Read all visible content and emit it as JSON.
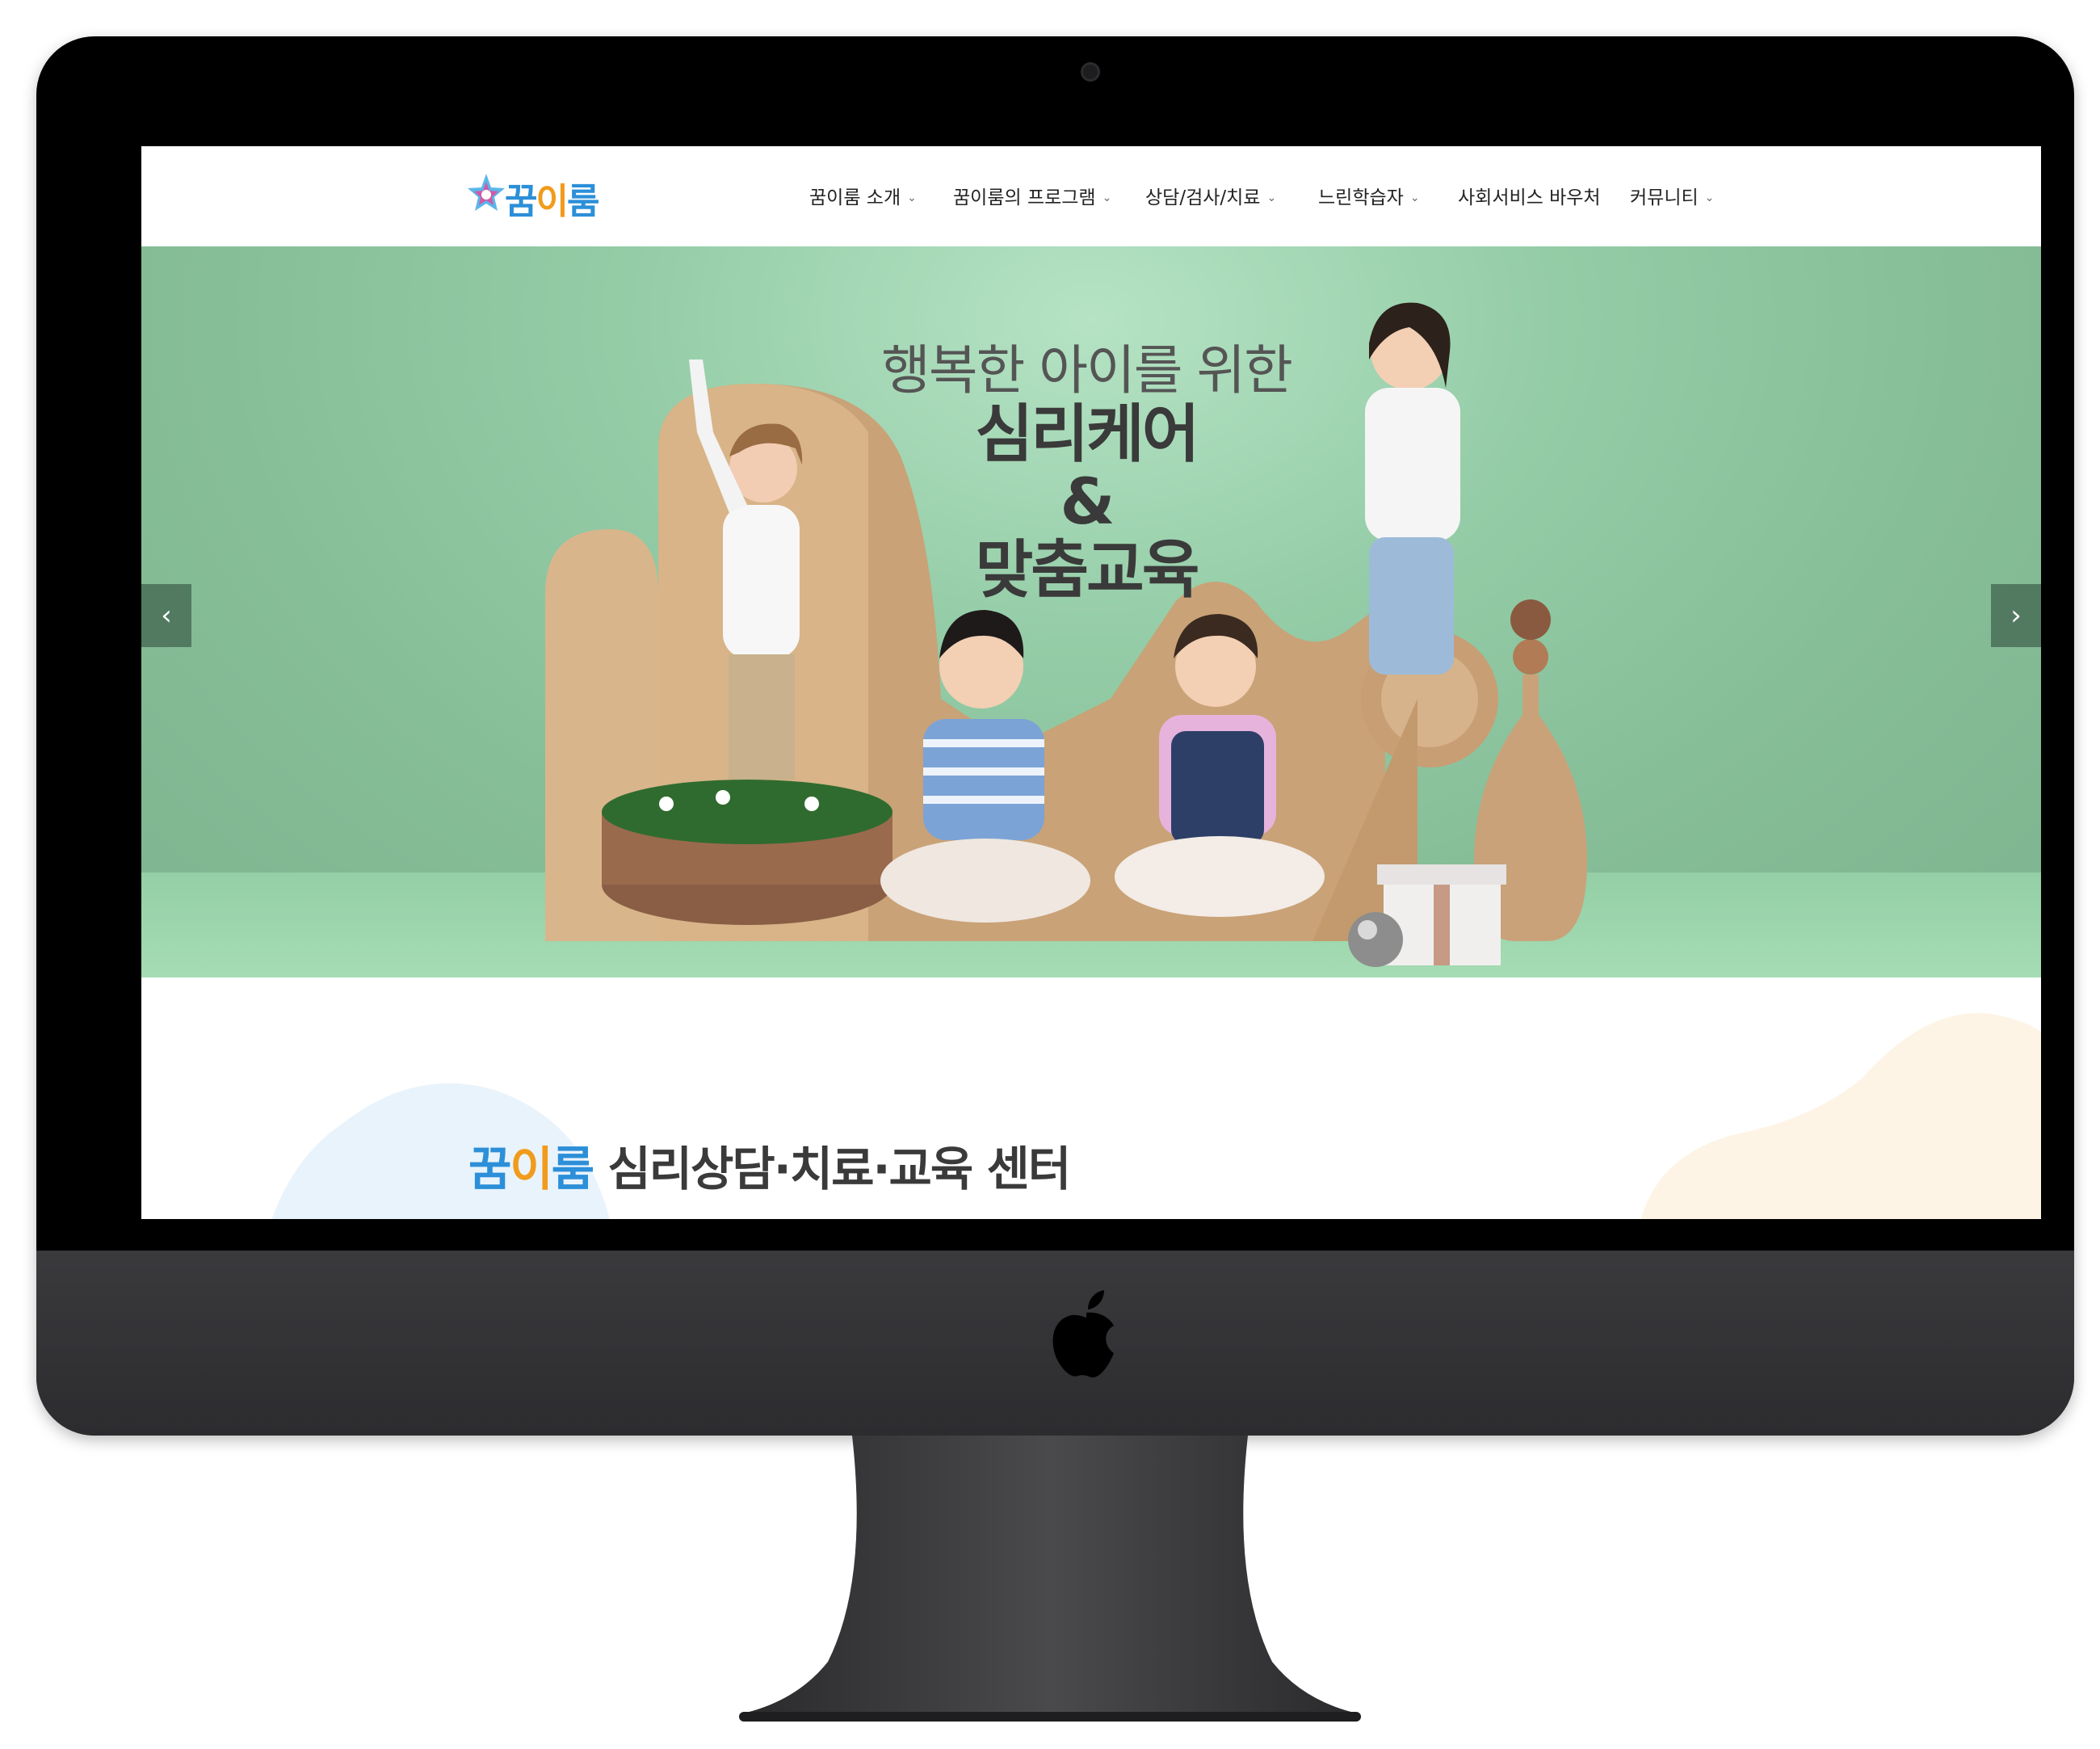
{
  "header": {
    "logo_text_a": "꿈",
    "logo_text_b": "이",
    "logo_text_c": "룸"
  },
  "nav": {
    "items": [
      {
        "label": "꿈이룸 소개",
        "has_dropdown": true
      },
      {
        "label": "꿈이룸의 프로그램",
        "has_dropdown": true
      },
      {
        "label": "상담/검사/치료",
        "has_dropdown": true
      },
      {
        "label": "느린학습자",
        "has_dropdown": true
      },
      {
        "label": "사회서비스 바우처",
        "has_dropdown": false
      },
      {
        "label": "커뮤니티",
        "has_dropdown": true
      }
    ]
  },
  "hero": {
    "subtitle": "행복한 아이를 위한",
    "line1": "심리케어",
    "line2": "&",
    "line3": "맞춤교육",
    "prev_icon": "chevron-left-icon",
    "next_icon": "chevron-right-icon"
  },
  "intro": {
    "brand_a": "꿈",
    "brand_b": "이",
    "brand_c": "룸",
    "title_rest": " 심리상담·치료·교육 센터"
  },
  "colors": {
    "brand_blue": "#2c8fd8",
    "brand_orange": "#f19b1c",
    "hero_green": "#94cca7"
  }
}
